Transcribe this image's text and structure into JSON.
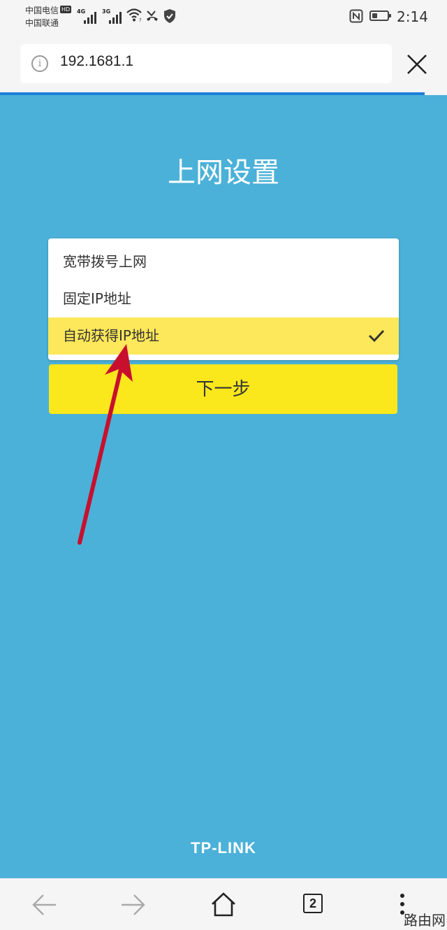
{
  "status_bar": {
    "carrier_1": "中国电信",
    "hd_badge": "HD",
    "carrier_2": "中国联通",
    "net_1": "4G",
    "net_2": "3G",
    "time": "2:14",
    "battery_level": 0.35
  },
  "browser": {
    "url": "192.1681.1",
    "info_icon": "info-icon",
    "close_icon": "close-icon",
    "load_progress": 0.95,
    "progress_color": "#1e7fd8"
  },
  "page": {
    "background_color": "#4bb1d8",
    "title": "上网设置",
    "options": [
      {
        "label": "宽带拨号上网",
        "selected": false
      },
      {
        "label": "固定IP地址",
        "selected": false
      },
      {
        "label": "自动获得IP地址",
        "selected": true
      }
    ],
    "selected_highlight_color": "#fde75a",
    "next_button": "下一步",
    "next_button_color": "#fbe81c",
    "brand": "TP-LINK",
    "annotation_arrow_color": "#c8102e"
  },
  "nav_bar": {
    "back_icon": "back-arrow-icon",
    "forward_icon": "forward-arrow-icon",
    "home_icon": "home-icon",
    "tab_count": "2",
    "menu_icon": "more-vertical-icon"
  },
  "watermark": "路由网"
}
